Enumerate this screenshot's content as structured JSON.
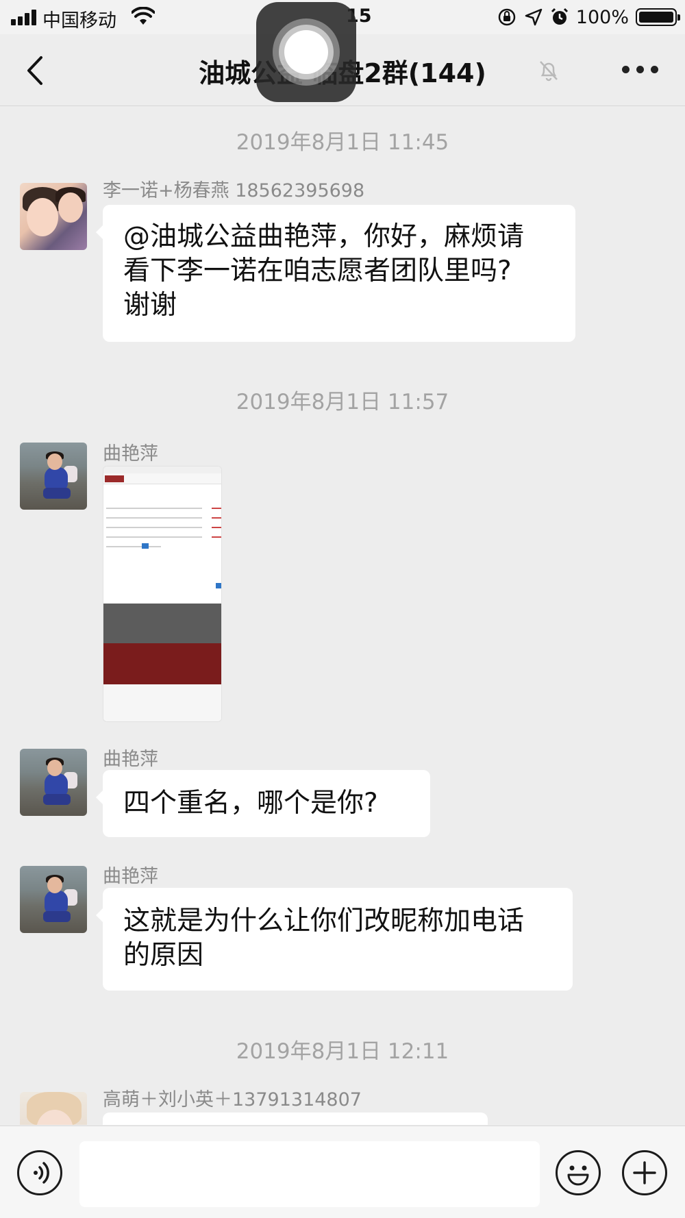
{
  "status_bar": {
    "carrier": "中国移动",
    "time": "15",
    "battery_percent": "100%",
    "icons": [
      "signal-icon",
      "wifi-icon",
      "orientation-lock-icon",
      "location-icon",
      "alarm-icon",
      "battery-icon"
    ]
  },
  "nav": {
    "title": "油城公益 临盘2群(144)",
    "back_icon": "chevron-left-icon",
    "mute_icon": "bell-muted-icon",
    "more_icon": "more-dots-icon"
  },
  "messages": [
    {
      "type": "timestamp",
      "text": "2019年8月1日 11:45"
    },
    {
      "type": "text",
      "sender": "李一诺+杨春燕 18562395698",
      "avatar": "avatar-two-girls",
      "lines": [
        "@油城公益曲艳萍，你好，麻烦请",
        "看下李一诺在咱志愿者团队里吗?",
        "谢谢"
      ]
    },
    {
      "type": "timestamp",
      "text": "2019年8月1日 11:57"
    },
    {
      "type": "image",
      "sender": "曲艳萍",
      "avatar": "avatar-woman-beach",
      "image": "screenshot-thumbnail"
    },
    {
      "type": "text",
      "sender": "曲艳萍",
      "avatar": "avatar-woman-beach",
      "lines": [
        "四个重名，哪个是你?"
      ]
    },
    {
      "type": "text",
      "sender": "曲艳萍",
      "avatar": "avatar-woman-beach",
      "lines": [
        "这就是为什么让你们改昵称加电话",
        "的原因"
      ]
    },
    {
      "type": "timestamp",
      "text": "2019年8月1日 12:11"
    },
    {
      "type": "text",
      "sender": "高萌＋刘小英＋13791314807",
      "avatar": "avatar-blonde",
      "lines": []
    }
  ],
  "input_bar": {
    "value": "",
    "icons": [
      "voice-icon",
      "emoji-icon",
      "plus-icon"
    ]
  },
  "colors": {
    "background": "#ededed",
    "bubble": "#ffffff",
    "timestamp": "#a3a3a3",
    "sender": "#8a8a8a"
  }
}
